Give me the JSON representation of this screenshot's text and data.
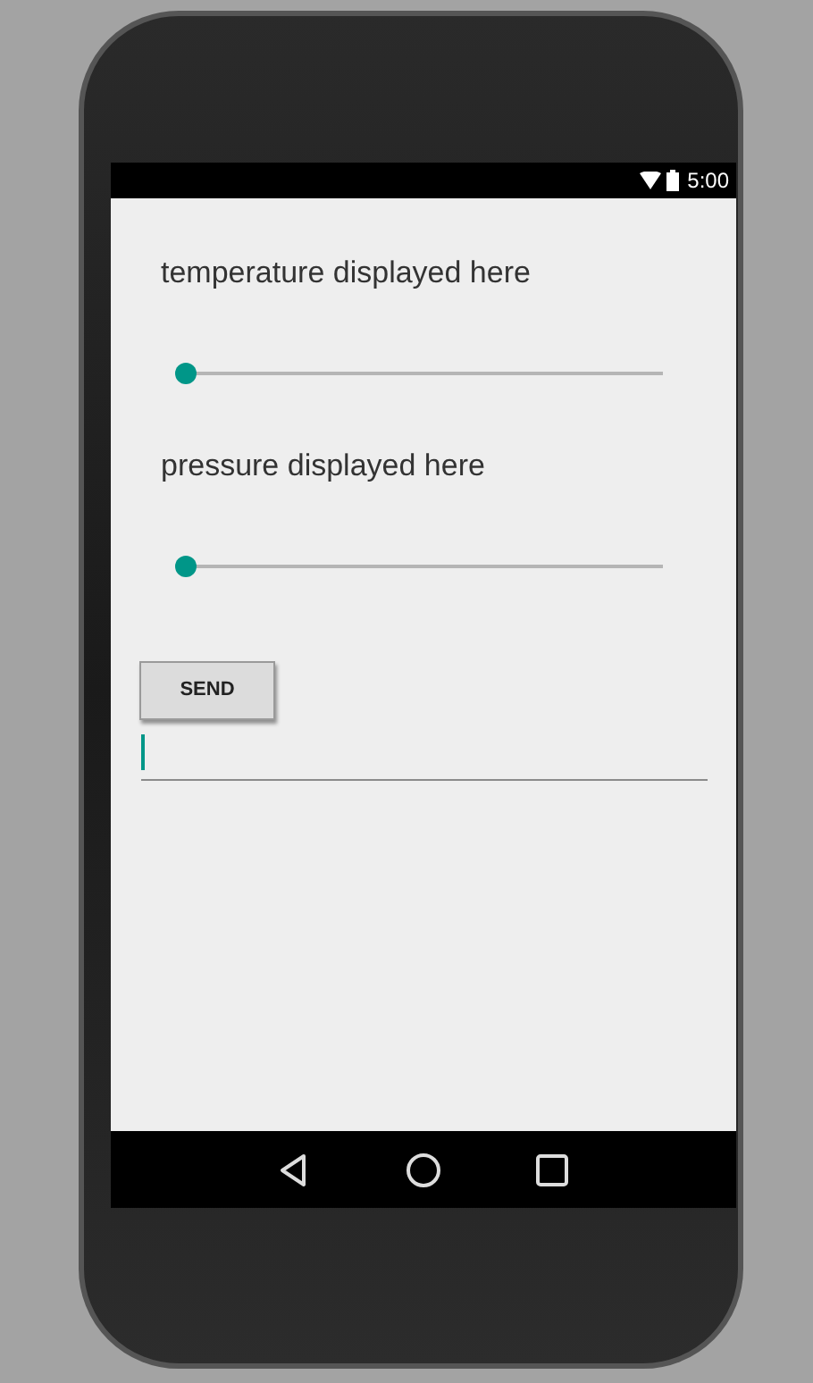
{
  "status_bar": {
    "time": "5:00"
  },
  "sensors": [
    {
      "label": "temperature displayed here",
      "slider": {
        "level": 0
      }
    },
    {
      "label": "pressure displayed here",
      "slider": {
        "level": 0
      }
    }
  ],
  "send_button": {
    "label": "SEND"
  },
  "message_field": {
    "focused": true
  },
  "nav_bar": {
    "buttons": [
      {
        "kind": "back"
      },
      {
        "kind": "home"
      },
      {
        "kind": "recents"
      }
    ]
  }
}
